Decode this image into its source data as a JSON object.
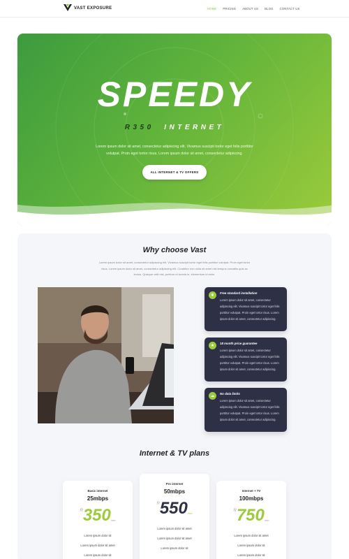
{
  "nav": {
    "brand": "VAST EXPOSURE",
    "items": [
      "HOME",
      "PRICING",
      "ABOUT US",
      "BLOG",
      "CONTACT US"
    ],
    "active": "HOME",
    "accent": "#8cc63f"
  },
  "hero": {
    "title": "SPEEDY",
    "sub_price": "R350",
    "sub_word": "INTERNET",
    "text": "Lorem ipsum dolor sit amet, consectetur adipiscing elit. Vivamus suscipit tortor eget felis porttitor volutpat. Proin eget tortor risus. Lorem ipsum dolor sit amet, consectetur adipiscing.",
    "button": "ALL INTERNET & TV OFFERS",
    "gradient": [
      "#3d9b3e",
      "#9ccb3b"
    ]
  },
  "why": {
    "title": "Why choose Vast",
    "lead": "Lorem ipsum dolor sit amet, consectetur adipiscing elit. Vivamus suscipit tortor eget felis porttitor volutpat. Proin eget tortor risus. Lorem ipsum dolor sit amet, consectetur adipiscing elit. Curabitur non nulla sit amet nisl tempus convallis quis ac lectus. Quisque velit nisi, pretium ut lacinia in, elementum id enim.",
    "features": [
      {
        "icon": "leaf-icon",
        "title": "Free standard installation",
        "text": "Lorem ipsum dolor sit amet, consectetur adipiscing elit. Vivamus suscipit tortor eget felis porttitor volutpat. Proin eget tortor risus. Lorem ipsum dolor sit amet, consectetur adipiscing."
      },
      {
        "icon": "star-icon",
        "title": "18 month price guarantee",
        "text": "Lorem ipsum dolor sit amet, consectetur adipiscing elit. Vivamus suscipit tortor eget felis porttitor volutpat. Proin eget tortor risus. Lorem ipsum dolor sit amet, consectetur adipiscing."
      },
      {
        "icon": "cloud-icon",
        "title": "No data limits",
        "text": "Lorem ipsum dolor sit amet, consectetur adipiscing elit. Vivamus suscipit tortor eget felis porttitor volutpat. Proin eget tortor risus. Lorem ipsum dolor sit amet, consectetur adipiscing."
      }
    ]
  },
  "plans": {
    "title": "Internet & TV plans",
    "items": [
      {
        "name": "Basic internet",
        "speed": "25mbps",
        "currency": "R",
        "price": "350",
        "period": "/mo",
        "lines": [
          "Lorem ipsum dolor sit",
          "Lorem ipsum dolor sit amet",
          "Lorem ipsum dolor sit"
        ]
      },
      {
        "name": "Pro internet",
        "speed": "50mbps",
        "currency": "R",
        "price": "550",
        "period": "/mo",
        "lines": [
          "Lorem ipsum dolor sit amet",
          "Lorem ipsum dolor sit amet",
          "Lorem ipsum dolor sit"
        ]
      },
      {
        "name": "Internet + TV",
        "speed": "100mbps",
        "currency": "R",
        "price": "750",
        "period": "/mo",
        "lines": [
          "Lorem ipsum dolor sit amet",
          "Lorem ipsum dolor sit",
          "Lorem ipsum dolor sit"
        ]
      }
    ]
  }
}
